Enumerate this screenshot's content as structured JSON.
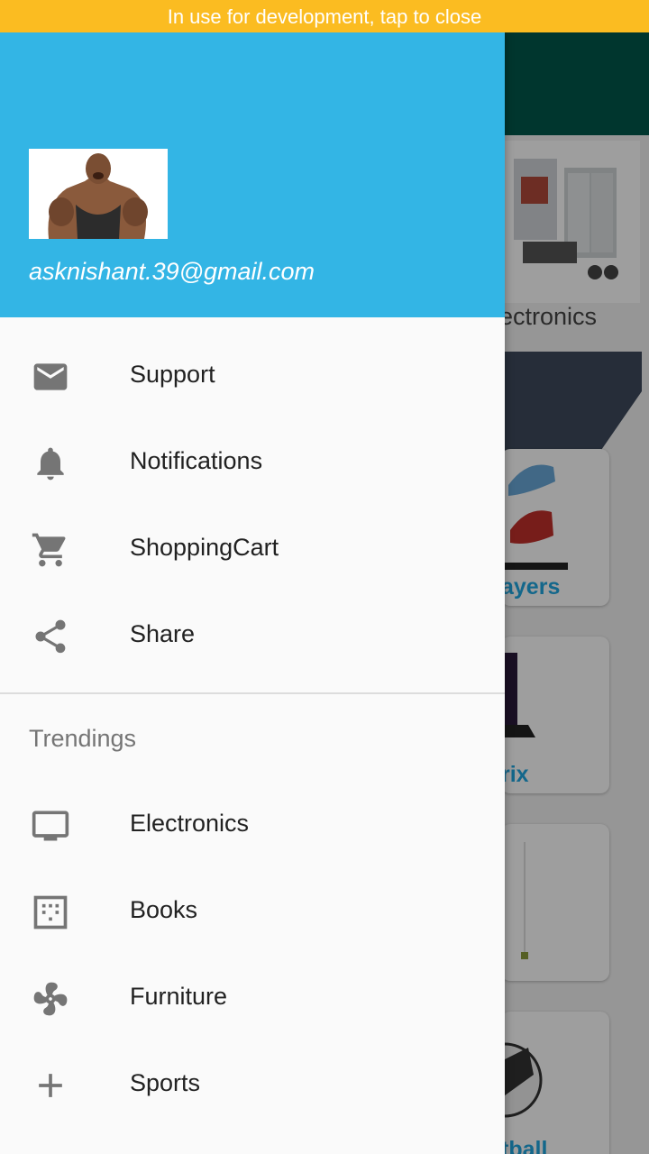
{
  "dev_banner": {
    "text": "In use for development, tap to close"
  },
  "background": {
    "category_label": "lectronics",
    "cards": [
      {
        "label": "ayers"
      },
      {
        "label": "rix"
      },
      {
        "label": ""
      },
      {
        "label": "tball"
      }
    ]
  },
  "drawer": {
    "header": {
      "email": "asknishant.39@gmail.com"
    },
    "items": [
      {
        "label": "Support",
        "icon": "mail-icon"
      },
      {
        "label": "Notifications",
        "icon": "bell-icon"
      },
      {
        "label": "ShoppingCart",
        "icon": "cart-icon"
      },
      {
        "label": "Share",
        "icon": "share-icon"
      }
    ],
    "subheader": "Trendings",
    "trending_items": [
      {
        "label": "Electronics",
        "icon": "tv-icon"
      },
      {
        "label": "Books",
        "icon": "dots-grid-icon"
      },
      {
        "label": "Furniture",
        "icon": "fan-icon"
      },
      {
        "label": "Sports",
        "icon": "plus-icon"
      }
    ]
  },
  "colors": {
    "header": "#33b5e5",
    "dev_banner": "#fbbc21",
    "toolbar": "#00574b",
    "icon": "#757575"
  }
}
